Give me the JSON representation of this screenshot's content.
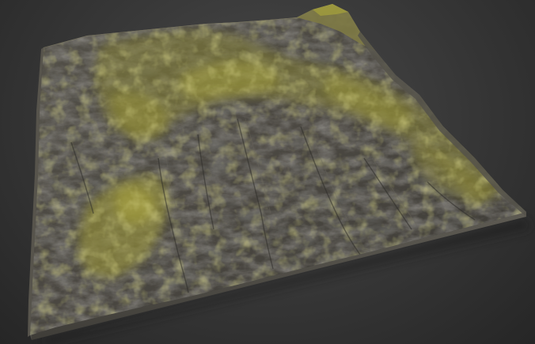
{
  "scene": {
    "subject": "terrain-model",
    "background_color": "#3a3a3a",
    "rock_color": "#4a4741",
    "moss_color": "#a7a23a",
    "edge_color": "#5b5850"
  }
}
